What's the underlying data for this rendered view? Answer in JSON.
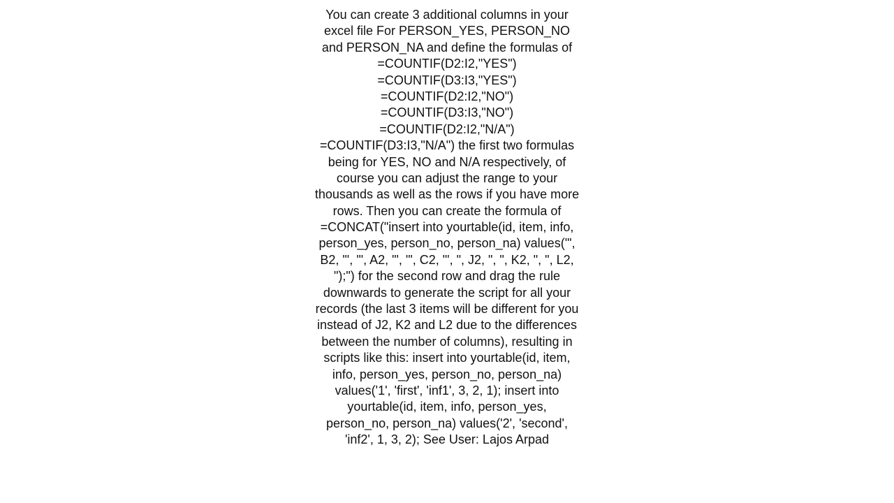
{
  "document": {
    "body_text": "You can create 3 additional columns in your excel file For PERSON_YES, PERSON_NO and PERSON_NA and define the formulas of  =COUNTIF(D2:I2,\"YES\")\n=COUNTIF(D3:I3,\"YES\")\n=COUNTIF(D2:I2,\"NO\")\n=COUNTIF(D3:I3,\"NO\")\n=COUNTIF(D2:I2,\"N/A\")\n=COUNTIF(D3:I3,\"N/A\")  the first two formulas being for YES, NO and N/A respectively, of course you can adjust the range to your thousands as well as the rows if you have more rows. Then you can create the formula of  =CONCAT(\"insert into yourtable(id, item, info, person_yes, person_no, person_na) values('\", B2, \"', '\", A2, \"', '\", C2, \"', \", J2, \", \", K2, \", \", L2, \");\")  for the second row and drag the rule downwards to generate the script for all your records (the last 3 items will be different for you instead of J2, K2 and L2 due to the differences between the number of columns), resulting in scripts like this: insert into yourtable(id, item, info, person_yes, person_no, person_na) values('1', 'first', 'inf1', 3, 2, 1); insert into yourtable(id, item, info, person_yes, person_no, person_na) values('2', 'second', 'inf2', 1, 3, 2);  See   User: Lajos Arpad"
  }
}
